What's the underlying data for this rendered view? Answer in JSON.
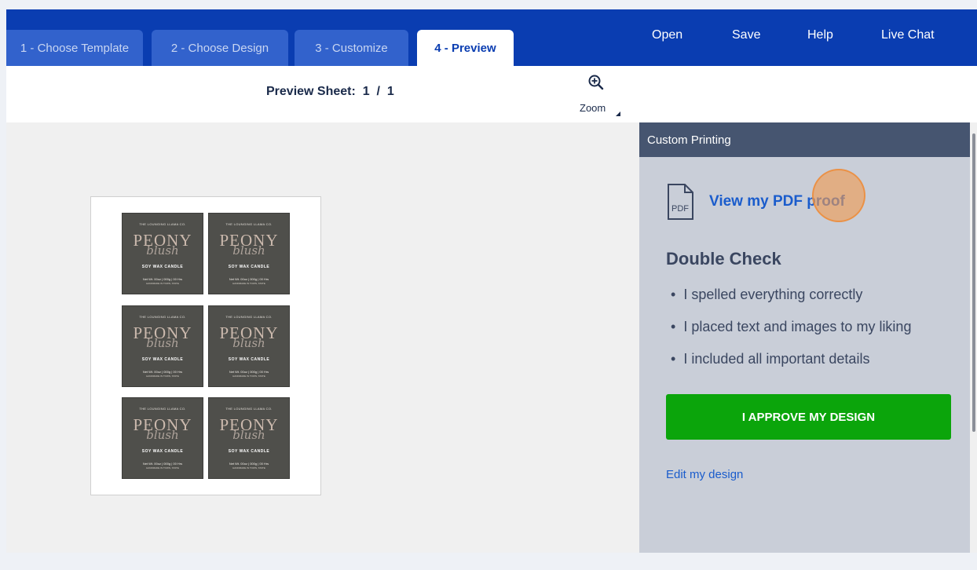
{
  "tabs": [
    {
      "label": "1 - Choose Template"
    },
    {
      "label": "2 - Choose Design"
    },
    {
      "label": "3 - Customize"
    },
    {
      "label": "4 - Preview"
    }
  ],
  "nav": {
    "open": "Open",
    "save": "Save",
    "help": "Help",
    "live_chat": "Live Chat"
  },
  "preview": {
    "sheet_text": "Preview Sheet:  1  /  1",
    "zoom_label": "Zoom"
  },
  "label_design": {
    "brand": "THE LOUNGING LLAMA CO.",
    "title": "PEONY",
    "script": "blush",
    "product": "SOY WAX CANDLE",
    "net": "Net Wt. 00oz | 000g | 00 Hrs",
    "handmade": "HANDMADE IN TOWN, STATE"
  },
  "panel": {
    "header": "Custom Printing",
    "pdf_icon_text": "PDF",
    "pdf_link": "View my PDF proof",
    "check_title": "Double Check",
    "checklist": [
      "I spelled everything correctly",
      "I placed text and images to my liking",
      "I included all important details"
    ],
    "approve_button": "I APPROVE MY DESIGN",
    "edit_link": "Edit my design"
  },
  "colors": {
    "topbar": "#0a3db1",
    "approve_green": "#0ba50b",
    "link_blue": "#1a5ccc",
    "panel_header": "#465570",
    "label_background": "#4f4f4b"
  }
}
